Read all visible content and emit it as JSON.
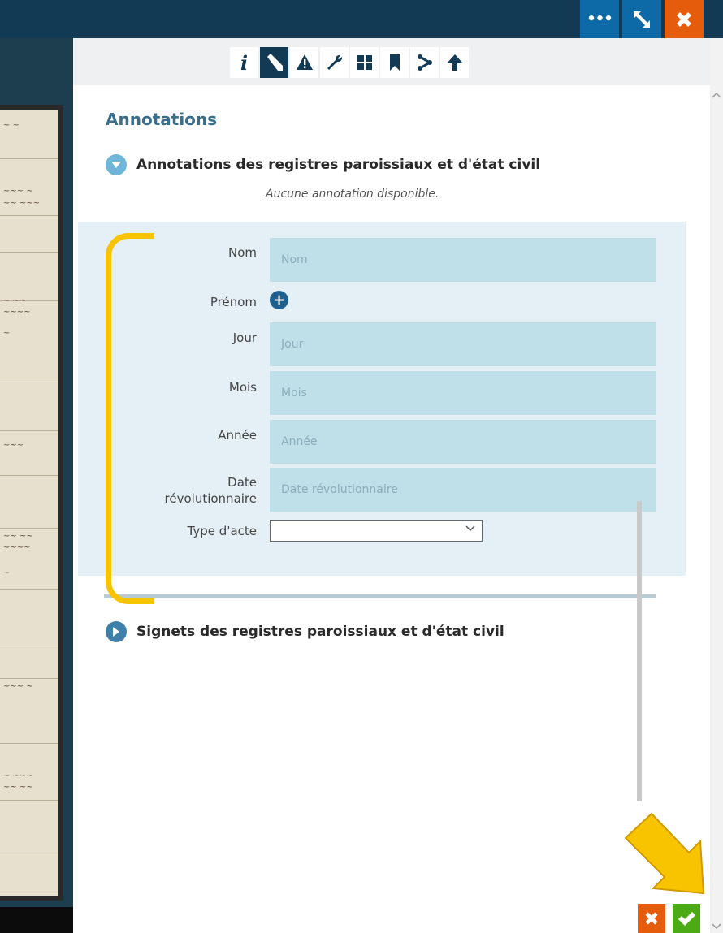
{
  "window": {
    "more_label": "•••",
    "expand_icon": "expand-icon",
    "close_icon": "close-icon",
    "colors": {
      "topbar": "#123a55",
      "more": "#0e6aa6",
      "expand": "#0e6aa6",
      "close": "#e65c0d"
    }
  },
  "tabs": [
    {
      "label": "i",
      "icon": "info-icon"
    },
    {
      "label": "",
      "icon": "pencil-icon",
      "active": true
    },
    {
      "label": "",
      "icon": "warning-icon"
    },
    {
      "label": "",
      "icon": "wrench-icon"
    },
    {
      "label": "",
      "icon": "grid-icon"
    },
    {
      "label": "",
      "icon": "bookmark-icon"
    },
    {
      "label": "",
      "icon": "share-icon"
    },
    {
      "label": "",
      "icon": "tree-icon"
    }
  ],
  "annotations": {
    "title": "Annotations",
    "section_registres": "Annotations des registres paroissiaux et d'état civil",
    "empty_message": "Aucune annotation disponible.",
    "section_signets": "Signets des registres paroissiaux et d'état civil"
  },
  "form": {
    "nom": {
      "label": "Nom",
      "placeholder": "Nom"
    },
    "prenom": {
      "label": "Prénom"
    },
    "jour": {
      "label": "Jour",
      "placeholder": "Jour"
    },
    "mois": {
      "label": "Mois",
      "placeholder": "Mois"
    },
    "annee": {
      "label": "Année",
      "placeholder": "Année"
    },
    "date_rev": {
      "label_1": "Date",
      "label_2": "révolutionnaire",
      "placeholder": "Date révolutionnaire"
    },
    "type_acte": {
      "label": "Type d'acte",
      "value": ""
    }
  },
  "actions": {
    "cancel_icon": "close-icon",
    "confirm_icon": "check-icon",
    "colors": {
      "cancel": "#e65c0d",
      "confirm": "#4caa14",
      "highlight": "#f8c400"
    }
  }
}
